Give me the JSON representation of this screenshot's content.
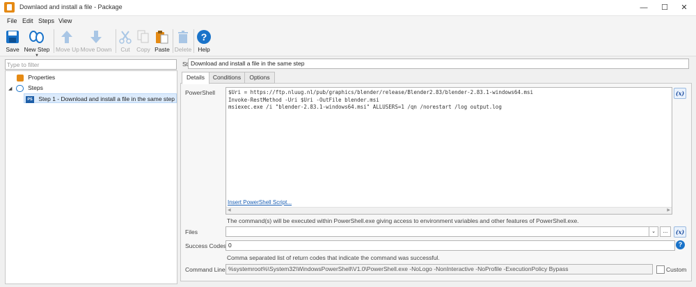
{
  "window": {
    "title": "Downlaod and install a file - Package",
    "minimize": "—",
    "maximize": "☐",
    "close": "✕"
  },
  "menu": [
    "File",
    "Edit",
    "Steps",
    "View"
  ],
  "toolbar": {
    "save": "Save",
    "new_step": "New Step",
    "move_up": "Move Up",
    "move_down": "Move Down",
    "cut": "Cut",
    "copy": "Copy",
    "paste": "Paste",
    "delete": "Delete",
    "help": "Help"
  },
  "left": {
    "filter_placeholder": "Type to filter",
    "tree": {
      "properties": "Properties",
      "steps": "Steps",
      "step1": "Step 1 - Download and install a file in the same step",
      "step1_badge": "PS"
    }
  },
  "right": {
    "step_title_label": "Step Title",
    "step_title_value": "Download and install a file in the same step",
    "tabs": [
      "Details",
      "Conditions",
      "Options"
    ],
    "powershell_label": "PowerShell",
    "powershell_code": "$Uri = https://ftp.nluug.nl/pub/graphics/blender/release/Blender2.83/blender-2.83.1-windows64.msi\nInvoke-RestMethod -Uri $Uri -OutFile blender.msi\nmsiexec.exe /i \"blender-2.83.1-windows64.msi\" ALLUSERS=1 /qn /norestart /log output.log",
    "insert_script_link": "Insert PowerShell Script...",
    "ps_hint": "The command(s) will be executed within PowerShell.exe giving access to environment variables and other features of PowerShell.exe.",
    "fx": "(x)",
    "files_label": "Files",
    "files_value": "",
    "browse": "...",
    "success_label": "Success Codes",
    "success_value": "0",
    "success_hint": "Comma separated list of return codes that indicate the command was successful.",
    "cmd_label": "Command Line",
    "cmd_value": "%systemroot%\\System32\\WindowsPowerShell\\V1.0\\PowerShell.exe -NoLogo -NonInteractive -NoProfile -ExecutionPolicy Bypass",
    "custom_label": "Custom",
    "help_glyph": "?"
  },
  "colors": {
    "accent_blue": "#1a73c9",
    "app_orange": "#e58a14",
    "selection": "#dcebfc"
  }
}
